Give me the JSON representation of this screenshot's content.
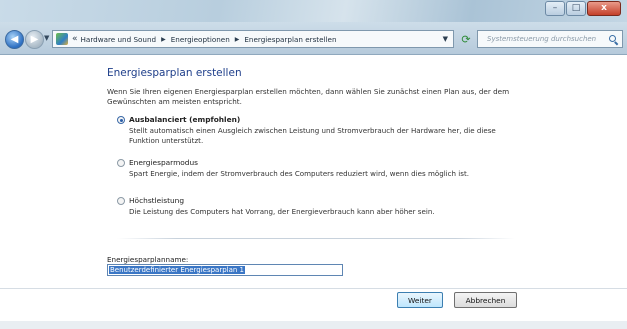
{
  "window": {
    "minimize_icon": "minimize-icon",
    "maximize_icon": "maximize-icon",
    "close_icon": "close-icon",
    "close_glyph": "x"
  },
  "nav": {
    "back_icon": "arrow-left-icon",
    "forward_icon": "arrow-right-icon",
    "address_icon": "control-panel-icon",
    "overflow": "«",
    "breadcrumbs": [
      "Hardware und Sound",
      "Energieoptionen",
      "Energiesparplan erstellen"
    ],
    "breadcrumb_separator_icon": "chevron-right-icon",
    "refresh_icon": "refresh-icon",
    "search_placeholder": "Systemsteuerung durchsuchen",
    "search_icon": "search-icon"
  },
  "main": {
    "title": "Energiesparplan erstellen",
    "intro": "Wenn Sie Ihren eigenen Energiesparplan erstellen möchten, dann wählen Sie zunächst einen Plan aus, der dem Gewünschten am meisten entspricht.",
    "options": [
      {
        "label": "Ausbalanciert (empfohlen)",
        "description": "Stellt automatisch einen Ausgleich zwischen Leistung und Stromverbrauch der Hardware her, die diese Funktion unterstützt.",
        "selected": true
      },
      {
        "label": "Energiesparmodus",
        "description": "Spart Energie, indem der Stromverbrauch des Computers reduziert wird, wenn dies möglich ist.",
        "selected": false
      },
      {
        "label": "Höchstleistung",
        "description": "Die Leistung des Computers hat Vorrang, der Energieverbrauch kann aber höher sein.",
        "selected": false
      }
    ],
    "plan_name_label": "Energiesparplanname:",
    "plan_name_value": "Benutzerdefinierter Energiesparplan 1"
  },
  "buttons": {
    "next": "Weiter",
    "cancel": "Abbrechen"
  },
  "colors": {
    "title_blue": "#1e3e8a",
    "selection_blue": "#3a76c5",
    "primary_button": "#bee6fd"
  }
}
